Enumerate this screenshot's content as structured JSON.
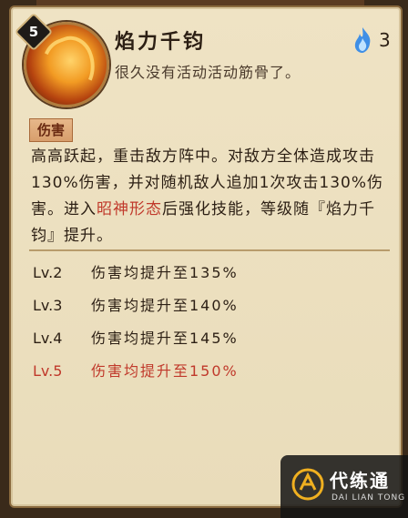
{
  "skill": {
    "level": "5",
    "name": "焰力千钧",
    "quote": "很久没有活动活动筋骨了。",
    "cost": "3",
    "cost_icon": "blue-flame-icon",
    "tag": "伤害",
    "desc_part1": "高高跃起，重击敌方阵中。对敌方全体造成攻击130%伤害，并对随机敌人追加1次攻击130%伤害。进入",
    "desc_highlight": "昭神形态",
    "desc_part2": "后强化技能，等级随『焰力千钧』提升。"
  },
  "levels": [
    {
      "lv": "Lv.2",
      "text": "伤害均提升至135%",
      "active": false
    },
    {
      "lv": "Lv.3",
      "text": "伤害均提升至140%",
      "active": false
    },
    {
      "lv": "Lv.4",
      "text": "伤害均提升至145%",
      "active": false
    },
    {
      "lv": "Lv.5",
      "text": "伤害均提升至150%",
      "active": true
    }
  ],
  "colors": {
    "highlight": "#c0392b",
    "panel_bg": "#efe3c4",
    "text": "#2c1f14"
  },
  "watermark": {
    "cn": "代练通",
    "en": "DAI LIAN TONG"
  }
}
